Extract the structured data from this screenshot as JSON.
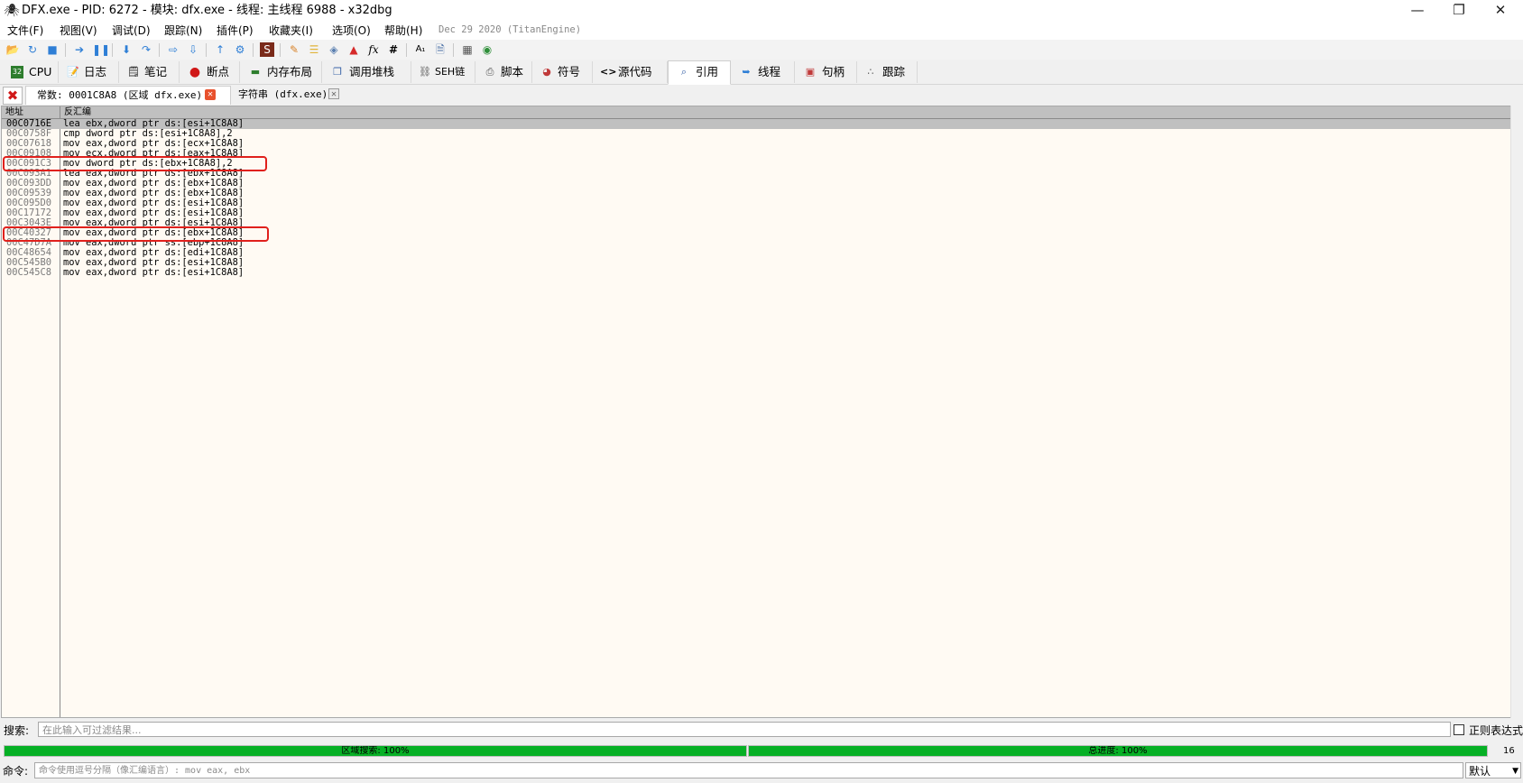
{
  "window": {
    "title": "DFX.exe - PID: 6272 - 模块: dfx.exe - 线程: 主线程 6988 - x32dbg",
    "app_icon": "bug-icon",
    "minimize_icon": "minimize-icon",
    "restore_icon": "restore-icon",
    "close_icon": "close-icon"
  },
  "menu": {
    "items": [
      "文件(F)",
      "视图(V)",
      "调试(D)",
      "跟踪(N)",
      "插件(P)",
      "收藏夹(I)",
      "选项(O)",
      "帮助(H)"
    ],
    "build_info": "Dec 29 2020 (TitanEngine)"
  },
  "toolbar": {
    "icons": [
      "open-icon",
      "restart-icon",
      "stop-icon",
      "run-icon",
      "pause-icon",
      "step-into-icon",
      "step-over-icon",
      "trace-into-icon",
      "trace-over-icon",
      "execute-till-return-icon",
      "run-to-user-code-icon",
      "scylla-icon",
      "patches-icon",
      "comments-icon",
      "labels-icon",
      "bookmarks-icon",
      "function-icon",
      "hash-icon",
      "font-size-icon",
      "strings-icon",
      "calculator-icon",
      "globe-icon"
    ]
  },
  "tabs": [
    {
      "label": "CPU",
      "icon": "cpu-icon"
    },
    {
      "label": "日志",
      "icon": "log-icon"
    },
    {
      "label": "笔记",
      "icon": "notes-icon"
    },
    {
      "label": "断点",
      "icon": "breakpoint-icon"
    },
    {
      "label": "内存布局",
      "icon": "memory-map-icon"
    },
    {
      "label": "调用堆栈",
      "icon": "call-stack-icon"
    },
    {
      "label": "SEH链",
      "icon": "seh-icon"
    },
    {
      "label": "脚本",
      "icon": "script-icon"
    },
    {
      "label": "符号",
      "icon": "symbols-icon"
    },
    {
      "label": "源代码",
      "icon": "source-icon"
    },
    {
      "label": "引用",
      "icon": "references-icon"
    },
    {
      "label": "线程",
      "icon": "threads-icon"
    },
    {
      "label": "句柄",
      "icon": "handles-icon"
    },
    {
      "label": "跟踪",
      "icon": "trace-icon"
    }
  ],
  "active_tab": "引用",
  "subtabs": [
    {
      "label": "常数: 0001C8A8 (区域 dfx.exe)"
    },
    {
      "label": "字符串 (dfx.exe)"
    }
  ],
  "table": {
    "headers": [
      "地址",
      "反汇编"
    ],
    "rows": [
      {
        "addr": "00C0716E",
        "dis": "lea ebx,dword ptr ds:[esi+1C8A8]"
      },
      {
        "addr": "00C0758F",
        "dis": "cmp dword ptr ds:[esi+1C8A8],2"
      },
      {
        "addr": "00C07618",
        "dis": "mov eax,dword ptr ds:[ecx+1C8A8]"
      },
      {
        "addr": "00C09108",
        "dis": "mov ecx,dword ptr ds:[eax+1C8A8]"
      },
      {
        "addr": "00C091C3",
        "dis": "mov dword ptr ds:[ebx+1C8A8],2"
      },
      {
        "addr": "00C093A1",
        "dis": "lea eax,dword ptr ds:[ebx+1C8A8]"
      },
      {
        "addr": "00C093DD",
        "dis": "mov eax,dword ptr ds:[ebx+1C8A8]"
      },
      {
        "addr": "00C09539",
        "dis": "mov eax,dword ptr ds:[ebx+1C8A8]"
      },
      {
        "addr": "00C095D0",
        "dis": "mov eax,dword ptr ds:[esi+1C8A8]"
      },
      {
        "addr": "00C17172",
        "dis": "mov eax,dword ptr ds:[esi+1C8A8]"
      },
      {
        "addr": "00C3043E",
        "dis": "mov eax,dword ptr ds:[esi+1C8A8]"
      },
      {
        "addr": "00C40327",
        "dis": "mov eax,dword ptr ds:[ebx+1C8A8]"
      },
      {
        "addr": "00C47D7A",
        "dis": "mov eax,dword ptr ss:[ebp+1C8A8]"
      },
      {
        "addr": "00C48654",
        "dis": "mov eax,dword ptr ds:[edi+1C8A8]"
      },
      {
        "addr": "00C545B0",
        "dis": "mov eax,dword ptr ds:[esi+1C8A8]"
      },
      {
        "addr": "00C545C8",
        "dis": "mov eax,dword ptr ds:[esi+1C8A8]"
      }
    ]
  },
  "search": {
    "label": "搜索:",
    "placeholder": "在此输入可过滤结果...",
    "regex_label": "正则表达式"
  },
  "progress": {
    "region_search": {
      "text": "区域搜索: 100%",
      "fraction": 1.0
    },
    "total_progress": {
      "text": "总进度: 100%",
      "fraction": 1.0
    },
    "count": "16"
  },
  "command": {
    "label": "命令:",
    "placeholder": "命令使用逗号分隔（像汇编语言）: mov eax, ebx",
    "mode": "默认"
  },
  "colors": {
    "progress_green": "#06b025",
    "highlight_red": "#e0201c",
    "table_bg": "#fffaf3",
    "selected_row": "#c0c0c0"
  }
}
